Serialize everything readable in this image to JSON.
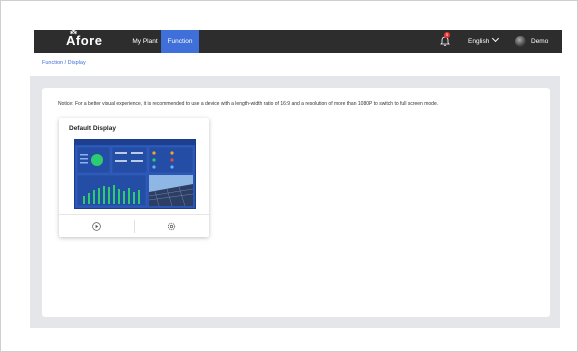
{
  "header": {
    "logo_text": "Afore",
    "nav": [
      "My Plant",
      "Function"
    ],
    "notification_count": "5",
    "language": "English",
    "user": "Demo"
  },
  "breadcrumb": "Function / Display",
  "notice": "Notice: For a better visual experience, it is recommended to use a device with a length-width ratio of 16:9 and a resolution of more than 1080P to switch to full screen mode.",
  "card": {
    "title": "Default Display",
    "actions": [
      "play-icon",
      "settings-icon"
    ]
  },
  "colors": {
    "header_bg": "#2d2d2d",
    "accent": "#3f6fd8",
    "page_bg": "#e4e6ea",
    "thumb_bg": "#2a56b5",
    "thumb_bars": "#2ecc71"
  }
}
